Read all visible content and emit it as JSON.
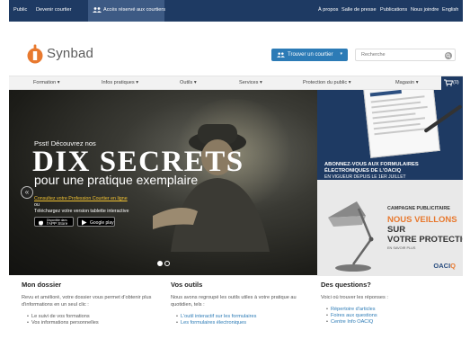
{
  "topbar": {
    "left_links": [
      "Public",
      "Devenir courtier"
    ],
    "active_link": "Accès réservé aux courtiers",
    "right_links": [
      "À propos",
      "Salle de presse",
      "Publications",
      "Nous joindre",
      "English"
    ]
  },
  "header": {
    "logo_text": "Synbad",
    "broker_button": "Trouver un courtier",
    "search_placeholder": "Recherche"
  },
  "nav": {
    "items": [
      "Formation",
      "Infos pratiques",
      "Outils",
      "Services",
      "Protection du public",
      "Magasin"
    ],
    "cart_count": "(0)"
  },
  "hero": {
    "kicker": "Psst! Découvrez nos",
    "headline": "DIX SECRETS",
    "subheadline": "pour une pratique exemplaire",
    "link_text": "Consultez votre Profession Courtier en ligne",
    "or_text": "ou",
    "tablet_text": "Téléchargez votre version tablette interactive",
    "appstore_small": "Disponible dans",
    "appstore_big": "l'APP Store",
    "googleplay": "Google play",
    "slides_total": 2,
    "slide_active": 1
  },
  "ad_forms": {
    "title": "ABONNEZ-VOUS AUX FORMULAIRES ÉLECTRONIQUES DE L'OACIQ",
    "subtitle": "EN VIGUEUR DEPUIS LE 1ER JUILLET"
  },
  "ad_campaign": {
    "label": "CAMPAGNE PUBLICITAIRE",
    "line1": "NOUS VEILLONS",
    "line2": "SUR",
    "line3": "VOTRE PROTECTION",
    "more": "EN SAVOIR PLUS",
    "brand_main": "OACI",
    "brand_accent": "Q"
  },
  "columns": [
    {
      "title": "Mon dossier",
      "text": "Revu et amélioré, votre dossier vous permet d'obtenir plus d'informations en un seul clic :",
      "items": [
        "Le suivi de vos formations",
        "Vos informations personnelles"
      ]
    },
    {
      "title": "Vos outils",
      "text": "Nous avons regroupé les outils utiles à votre pratique au quotidien, tels :",
      "items": [
        "L'outil interactif sur les formulaires",
        "Les formulaires électroniques"
      ]
    },
    {
      "title": "Des questions?",
      "text": "Voici où trouver les réponses :",
      "items": [
        "Répertoire d'articles",
        "Foires aux questions",
        "Centre Info OACIQ"
      ]
    }
  ],
  "colors": {
    "navy": "#1e3a63",
    "accent_blue": "#2c7bb6",
    "orange": "#e8792f"
  }
}
